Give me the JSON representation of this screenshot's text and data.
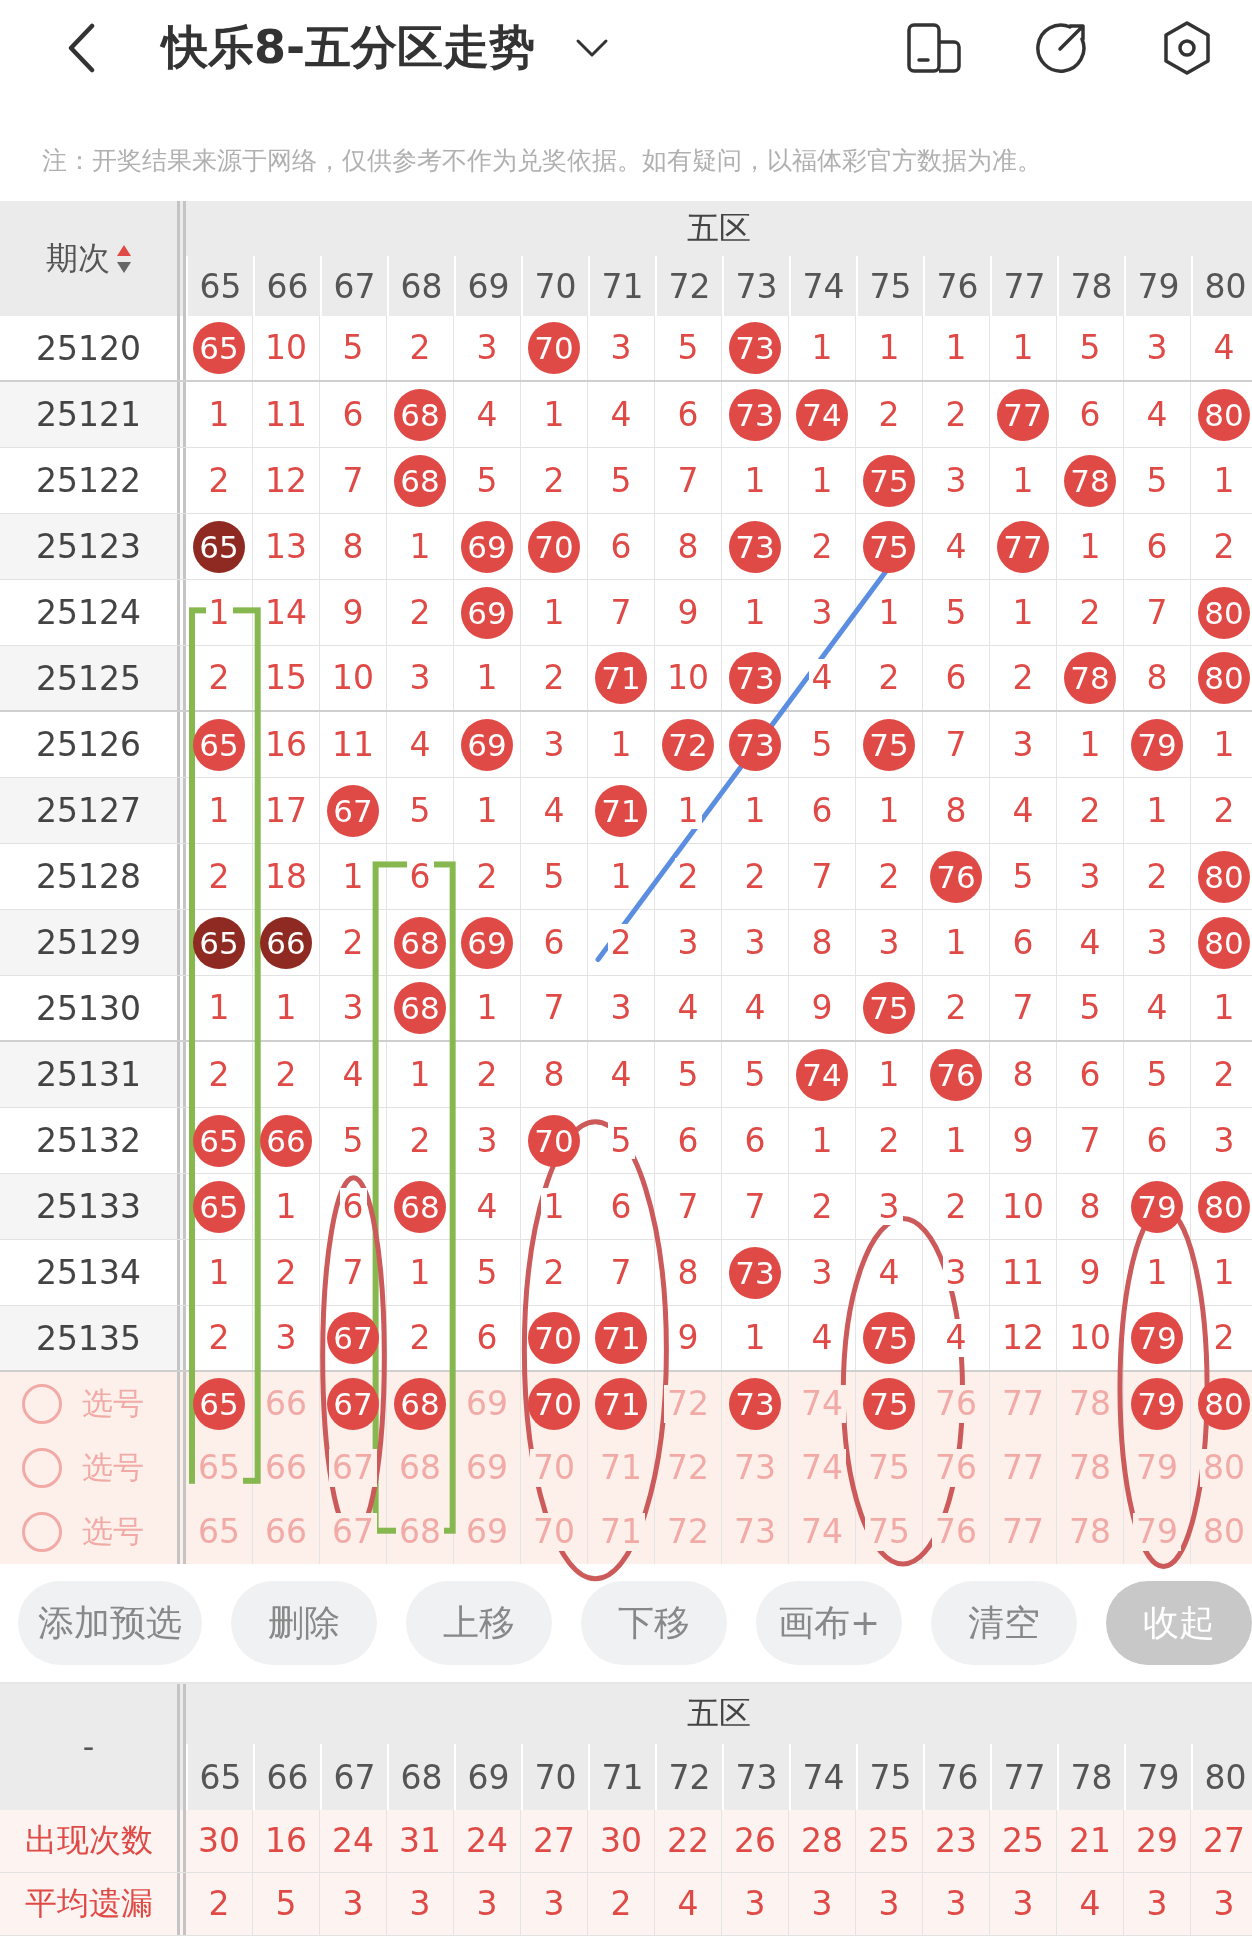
{
  "header": {
    "title": "快乐8-五分区走势"
  },
  "note": "注：开奖结果来源于网络，仅供参考不作为兑奖依据。如有疑问，以福体彩官方数据为准。",
  "trend_table": {
    "issue_heading": "期次",
    "group_heading": "五区",
    "columns": [
      "65",
      "66",
      "67",
      "68",
      "69",
      "70",
      "71",
      "72",
      "73",
      "74",
      "75",
      "76",
      "77",
      "78",
      "79",
      "80"
    ],
    "rows": [
      {
        "issue": "25120",
        "cells": [
          {
            "text": "65",
            "kind": "hit"
          },
          {
            "text": "10",
            "kind": "miss"
          },
          {
            "text": "5",
            "kind": "miss"
          },
          {
            "text": "2",
            "kind": "miss"
          },
          {
            "text": "3",
            "kind": "miss"
          },
          {
            "text": "70",
            "kind": "hit"
          },
          {
            "text": "3",
            "kind": "miss"
          },
          {
            "text": "5",
            "kind": "miss"
          },
          {
            "text": "73",
            "kind": "hit"
          },
          {
            "text": "1",
            "kind": "miss"
          },
          {
            "text": "1",
            "kind": "miss"
          },
          {
            "text": "1",
            "kind": "miss"
          },
          {
            "text": "1",
            "kind": "miss"
          },
          {
            "text": "5",
            "kind": "miss"
          },
          {
            "text": "3",
            "kind": "miss"
          },
          {
            "text": "4",
            "kind": "miss"
          }
        ]
      },
      {
        "issue": "25121",
        "cells": [
          {
            "text": "1",
            "kind": "miss"
          },
          {
            "text": "11",
            "kind": "miss"
          },
          {
            "text": "6",
            "kind": "miss"
          },
          {
            "text": "68",
            "kind": "hit"
          },
          {
            "text": "4",
            "kind": "miss"
          },
          {
            "text": "1",
            "kind": "miss"
          },
          {
            "text": "4",
            "kind": "miss"
          },
          {
            "text": "6",
            "kind": "miss"
          },
          {
            "text": "73",
            "kind": "hit"
          },
          {
            "text": "74",
            "kind": "hit"
          },
          {
            "text": "2",
            "kind": "miss"
          },
          {
            "text": "2",
            "kind": "miss"
          },
          {
            "text": "77",
            "kind": "hit"
          },
          {
            "text": "6",
            "kind": "miss"
          },
          {
            "text": "4",
            "kind": "miss"
          },
          {
            "text": "80",
            "kind": "hit"
          }
        ]
      },
      {
        "issue": "25122",
        "cells": [
          {
            "text": "2",
            "kind": "miss"
          },
          {
            "text": "12",
            "kind": "miss"
          },
          {
            "text": "7",
            "kind": "miss"
          },
          {
            "text": "68",
            "kind": "hit"
          },
          {
            "text": "5",
            "kind": "miss"
          },
          {
            "text": "2",
            "kind": "miss"
          },
          {
            "text": "5",
            "kind": "miss"
          },
          {
            "text": "7",
            "kind": "miss"
          },
          {
            "text": "1",
            "kind": "miss"
          },
          {
            "text": "1",
            "kind": "miss"
          },
          {
            "text": "75",
            "kind": "hit"
          },
          {
            "text": "3",
            "kind": "miss"
          },
          {
            "text": "1",
            "kind": "miss"
          },
          {
            "text": "78",
            "kind": "hit"
          },
          {
            "text": "5",
            "kind": "miss"
          },
          {
            "text": "1",
            "kind": "miss"
          }
        ]
      },
      {
        "issue": "25123",
        "cells": [
          {
            "text": "65",
            "kind": "repeat"
          },
          {
            "text": "13",
            "kind": "miss"
          },
          {
            "text": "8",
            "kind": "miss"
          },
          {
            "text": "1",
            "kind": "miss"
          },
          {
            "text": "69",
            "kind": "hit"
          },
          {
            "text": "70",
            "kind": "hit"
          },
          {
            "text": "6",
            "kind": "miss"
          },
          {
            "text": "8",
            "kind": "miss"
          },
          {
            "text": "73",
            "kind": "hit"
          },
          {
            "text": "2",
            "kind": "miss"
          },
          {
            "text": "75",
            "kind": "hit"
          },
          {
            "text": "4",
            "kind": "miss"
          },
          {
            "text": "77",
            "kind": "hit"
          },
          {
            "text": "1",
            "kind": "miss"
          },
          {
            "text": "6",
            "kind": "miss"
          },
          {
            "text": "2",
            "kind": "miss"
          }
        ]
      },
      {
        "issue": "25124",
        "cells": [
          {
            "text": "1",
            "kind": "miss"
          },
          {
            "text": "14",
            "kind": "miss"
          },
          {
            "text": "9",
            "kind": "miss"
          },
          {
            "text": "2",
            "kind": "miss"
          },
          {
            "text": "69",
            "kind": "hit"
          },
          {
            "text": "1",
            "kind": "miss"
          },
          {
            "text": "7",
            "kind": "miss"
          },
          {
            "text": "9",
            "kind": "miss"
          },
          {
            "text": "1",
            "kind": "miss"
          },
          {
            "text": "3",
            "kind": "miss"
          },
          {
            "text": "1",
            "kind": "miss"
          },
          {
            "text": "5",
            "kind": "miss"
          },
          {
            "text": "1",
            "kind": "miss"
          },
          {
            "text": "2",
            "kind": "miss"
          },
          {
            "text": "7",
            "kind": "miss"
          },
          {
            "text": "80",
            "kind": "hit"
          }
        ]
      },
      {
        "issue": "25125",
        "cells": [
          {
            "text": "2",
            "kind": "miss"
          },
          {
            "text": "15",
            "kind": "miss"
          },
          {
            "text": "10",
            "kind": "miss"
          },
          {
            "text": "3",
            "kind": "miss"
          },
          {
            "text": "1",
            "kind": "miss"
          },
          {
            "text": "2",
            "kind": "miss"
          },
          {
            "text": "71",
            "kind": "hit"
          },
          {
            "text": "10",
            "kind": "miss"
          },
          {
            "text": "73",
            "kind": "hit"
          },
          {
            "text": "4",
            "kind": "miss"
          },
          {
            "text": "2",
            "kind": "miss"
          },
          {
            "text": "6",
            "kind": "miss"
          },
          {
            "text": "2",
            "kind": "miss"
          },
          {
            "text": "78",
            "kind": "hit"
          },
          {
            "text": "8",
            "kind": "miss"
          },
          {
            "text": "80",
            "kind": "hit"
          }
        ]
      },
      {
        "issue": "25126",
        "cells": [
          {
            "text": "65",
            "kind": "hit"
          },
          {
            "text": "16",
            "kind": "miss"
          },
          {
            "text": "11",
            "kind": "miss"
          },
          {
            "text": "4",
            "kind": "miss"
          },
          {
            "text": "69",
            "kind": "hit"
          },
          {
            "text": "3",
            "kind": "miss"
          },
          {
            "text": "1",
            "kind": "miss"
          },
          {
            "text": "72",
            "kind": "hit"
          },
          {
            "text": "73",
            "kind": "hit"
          },
          {
            "text": "5",
            "kind": "miss"
          },
          {
            "text": "75",
            "kind": "hit"
          },
          {
            "text": "7",
            "kind": "miss"
          },
          {
            "text": "3",
            "kind": "miss"
          },
          {
            "text": "1",
            "kind": "miss"
          },
          {
            "text": "79",
            "kind": "hit"
          },
          {
            "text": "1",
            "kind": "miss"
          }
        ]
      },
      {
        "issue": "25127",
        "cells": [
          {
            "text": "1",
            "kind": "miss"
          },
          {
            "text": "17",
            "kind": "miss"
          },
          {
            "text": "67",
            "kind": "hit"
          },
          {
            "text": "5",
            "kind": "miss"
          },
          {
            "text": "1",
            "kind": "miss"
          },
          {
            "text": "4",
            "kind": "miss"
          },
          {
            "text": "71",
            "kind": "hit"
          },
          {
            "text": "1",
            "kind": "miss"
          },
          {
            "text": "1",
            "kind": "miss"
          },
          {
            "text": "6",
            "kind": "miss"
          },
          {
            "text": "1",
            "kind": "miss"
          },
          {
            "text": "8",
            "kind": "miss"
          },
          {
            "text": "4",
            "kind": "miss"
          },
          {
            "text": "2",
            "kind": "miss"
          },
          {
            "text": "1",
            "kind": "miss"
          },
          {
            "text": "2",
            "kind": "miss"
          }
        ]
      },
      {
        "issue": "25128",
        "cells": [
          {
            "text": "2",
            "kind": "miss"
          },
          {
            "text": "18",
            "kind": "miss"
          },
          {
            "text": "1",
            "kind": "miss"
          },
          {
            "text": "6",
            "kind": "miss"
          },
          {
            "text": "2",
            "kind": "miss"
          },
          {
            "text": "5",
            "kind": "miss"
          },
          {
            "text": "1",
            "kind": "miss"
          },
          {
            "text": "2",
            "kind": "miss"
          },
          {
            "text": "2",
            "kind": "miss"
          },
          {
            "text": "7",
            "kind": "miss"
          },
          {
            "text": "2",
            "kind": "miss"
          },
          {
            "text": "76",
            "kind": "hit"
          },
          {
            "text": "5",
            "kind": "miss"
          },
          {
            "text": "3",
            "kind": "miss"
          },
          {
            "text": "2",
            "kind": "miss"
          },
          {
            "text": "80",
            "kind": "hit"
          }
        ]
      },
      {
        "issue": "25129",
        "cells": [
          {
            "text": "65",
            "kind": "repeat"
          },
          {
            "text": "66",
            "kind": "repeat"
          },
          {
            "text": "2",
            "kind": "miss"
          },
          {
            "text": "68",
            "kind": "hit"
          },
          {
            "text": "69",
            "kind": "hit"
          },
          {
            "text": "6",
            "kind": "miss"
          },
          {
            "text": "2",
            "kind": "miss"
          },
          {
            "text": "3",
            "kind": "miss"
          },
          {
            "text": "3",
            "kind": "miss"
          },
          {
            "text": "8",
            "kind": "miss"
          },
          {
            "text": "3",
            "kind": "miss"
          },
          {
            "text": "1",
            "kind": "miss"
          },
          {
            "text": "6",
            "kind": "miss"
          },
          {
            "text": "4",
            "kind": "miss"
          },
          {
            "text": "3",
            "kind": "miss"
          },
          {
            "text": "80",
            "kind": "hit"
          }
        ]
      },
      {
        "issue": "25130",
        "cells": [
          {
            "text": "1",
            "kind": "miss"
          },
          {
            "text": "1",
            "kind": "miss"
          },
          {
            "text": "3",
            "kind": "miss"
          },
          {
            "text": "68",
            "kind": "hit"
          },
          {
            "text": "1",
            "kind": "miss"
          },
          {
            "text": "7",
            "kind": "miss"
          },
          {
            "text": "3",
            "kind": "miss"
          },
          {
            "text": "4",
            "kind": "miss"
          },
          {
            "text": "4",
            "kind": "miss"
          },
          {
            "text": "9",
            "kind": "miss"
          },
          {
            "text": "75",
            "kind": "hit"
          },
          {
            "text": "2",
            "kind": "miss"
          },
          {
            "text": "7",
            "kind": "miss"
          },
          {
            "text": "5",
            "kind": "miss"
          },
          {
            "text": "4",
            "kind": "miss"
          },
          {
            "text": "1",
            "kind": "miss"
          }
        ]
      },
      {
        "issue": "25131",
        "cells": [
          {
            "text": "2",
            "kind": "miss"
          },
          {
            "text": "2",
            "kind": "miss"
          },
          {
            "text": "4",
            "kind": "miss"
          },
          {
            "text": "1",
            "kind": "miss"
          },
          {
            "text": "2",
            "kind": "miss"
          },
          {
            "text": "8",
            "kind": "miss"
          },
          {
            "text": "4",
            "kind": "miss"
          },
          {
            "text": "5",
            "kind": "miss"
          },
          {
            "text": "5",
            "kind": "miss"
          },
          {
            "text": "74",
            "kind": "hit"
          },
          {
            "text": "1",
            "kind": "miss"
          },
          {
            "text": "76",
            "kind": "hit"
          },
          {
            "text": "8",
            "kind": "miss"
          },
          {
            "text": "6",
            "kind": "miss"
          },
          {
            "text": "5",
            "kind": "miss"
          },
          {
            "text": "2",
            "kind": "miss"
          }
        ]
      },
      {
        "issue": "25132",
        "cells": [
          {
            "text": "65",
            "kind": "hit"
          },
          {
            "text": "66",
            "kind": "hit"
          },
          {
            "text": "5",
            "kind": "miss"
          },
          {
            "text": "2",
            "kind": "miss"
          },
          {
            "text": "3",
            "kind": "miss"
          },
          {
            "text": "70",
            "kind": "hit"
          },
          {
            "text": "5",
            "kind": "miss"
          },
          {
            "text": "6",
            "kind": "miss"
          },
          {
            "text": "6",
            "kind": "miss"
          },
          {
            "text": "1",
            "kind": "miss"
          },
          {
            "text": "2",
            "kind": "miss"
          },
          {
            "text": "1",
            "kind": "miss"
          },
          {
            "text": "9",
            "kind": "miss"
          },
          {
            "text": "7",
            "kind": "miss"
          },
          {
            "text": "6",
            "kind": "miss"
          },
          {
            "text": "3",
            "kind": "miss"
          }
        ]
      },
      {
        "issue": "25133",
        "cells": [
          {
            "text": "65",
            "kind": "hit"
          },
          {
            "text": "1",
            "kind": "miss"
          },
          {
            "text": "6",
            "kind": "miss"
          },
          {
            "text": "68",
            "kind": "hit"
          },
          {
            "text": "4",
            "kind": "miss"
          },
          {
            "text": "1",
            "kind": "miss"
          },
          {
            "text": "6",
            "kind": "miss"
          },
          {
            "text": "7",
            "kind": "miss"
          },
          {
            "text": "7",
            "kind": "miss"
          },
          {
            "text": "2",
            "kind": "miss"
          },
          {
            "text": "3",
            "kind": "miss"
          },
          {
            "text": "2",
            "kind": "miss"
          },
          {
            "text": "10",
            "kind": "miss"
          },
          {
            "text": "8",
            "kind": "miss"
          },
          {
            "text": "79",
            "kind": "hit"
          },
          {
            "text": "80",
            "kind": "hit"
          }
        ]
      },
      {
        "issue": "25134",
        "cells": [
          {
            "text": "1",
            "kind": "miss"
          },
          {
            "text": "2",
            "kind": "miss"
          },
          {
            "text": "7",
            "kind": "miss"
          },
          {
            "text": "1",
            "kind": "miss"
          },
          {
            "text": "5",
            "kind": "miss"
          },
          {
            "text": "2",
            "kind": "miss"
          },
          {
            "text": "7",
            "kind": "miss"
          },
          {
            "text": "8",
            "kind": "miss"
          },
          {
            "text": "73",
            "kind": "hit"
          },
          {
            "text": "3",
            "kind": "miss"
          },
          {
            "text": "4",
            "kind": "miss"
          },
          {
            "text": "3",
            "kind": "miss"
          },
          {
            "text": "11",
            "kind": "miss"
          },
          {
            "text": "9",
            "kind": "miss"
          },
          {
            "text": "1",
            "kind": "miss"
          },
          {
            "text": "1",
            "kind": "miss"
          }
        ]
      },
      {
        "issue": "25135",
        "cells": [
          {
            "text": "2",
            "kind": "miss"
          },
          {
            "text": "3",
            "kind": "miss"
          },
          {
            "text": "67",
            "kind": "hit"
          },
          {
            "text": "2",
            "kind": "miss"
          },
          {
            "text": "6",
            "kind": "miss"
          },
          {
            "text": "70",
            "kind": "hit"
          },
          {
            "text": "71",
            "kind": "hit"
          },
          {
            "text": "9",
            "kind": "miss"
          },
          {
            "text": "1",
            "kind": "miss"
          },
          {
            "text": "4",
            "kind": "miss"
          },
          {
            "text": "75",
            "kind": "hit"
          },
          {
            "text": "4",
            "kind": "miss"
          },
          {
            "text": "12",
            "kind": "miss"
          },
          {
            "text": "10",
            "kind": "miss"
          },
          {
            "text": "79",
            "kind": "hit"
          },
          {
            "text": "2",
            "kind": "miss"
          }
        ]
      }
    ],
    "pick_rows": [
      {
        "label": "选号",
        "selected": false,
        "cells": [
          {
            "text": "65",
            "kind": "hit"
          },
          {
            "text": "66",
            "kind": "faint"
          },
          {
            "text": "67",
            "kind": "hit"
          },
          {
            "text": "68",
            "kind": "hit"
          },
          {
            "text": "69",
            "kind": "faint"
          },
          {
            "text": "70",
            "kind": "hit"
          },
          {
            "text": "71",
            "kind": "hit"
          },
          {
            "text": "72",
            "kind": "faint"
          },
          {
            "text": "73",
            "kind": "hit"
          },
          {
            "text": "74",
            "kind": "faint"
          },
          {
            "text": "75",
            "kind": "hit"
          },
          {
            "text": "76",
            "kind": "faint"
          },
          {
            "text": "77",
            "kind": "faint"
          },
          {
            "text": "78",
            "kind": "faint"
          },
          {
            "text": "79",
            "kind": "hit"
          },
          {
            "text": "80",
            "kind": "hit"
          }
        ]
      },
      {
        "label": "选号",
        "selected": false,
        "cells": [
          {
            "text": "65",
            "kind": "faint"
          },
          {
            "text": "66",
            "kind": "faint"
          },
          {
            "text": "67",
            "kind": "faint"
          },
          {
            "text": "68",
            "kind": "faint"
          },
          {
            "text": "69",
            "kind": "faint"
          },
          {
            "text": "70",
            "kind": "faint"
          },
          {
            "text": "71",
            "kind": "faint"
          },
          {
            "text": "72",
            "kind": "faint"
          },
          {
            "text": "73",
            "kind": "faint"
          },
          {
            "text": "74",
            "kind": "faint"
          },
          {
            "text": "75",
            "kind": "faint"
          },
          {
            "text": "76",
            "kind": "faint"
          },
          {
            "text": "77",
            "kind": "faint"
          },
          {
            "text": "78",
            "kind": "faint"
          },
          {
            "text": "79",
            "kind": "faint"
          },
          {
            "text": "80",
            "kind": "faint"
          }
        ]
      },
      {
        "label": "选号",
        "selected": false,
        "cells": [
          {
            "text": "65",
            "kind": "faint"
          },
          {
            "text": "66",
            "kind": "faint"
          },
          {
            "text": "67",
            "kind": "faint"
          },
          {
            "text": "68",
            "kind": "faint"
          },
          {
            "text": "69",
            "kind": "faint"
          },
          {
            "text": "70",
            "kind": "faint"
          },
          {
            "text": "71",
            "kind": "faint"
          },
          {
            "text": "72",
            "kind": "faint"
          },
          {
            "text": "73",
            "kind": "faint"
          },
          {
            "text": "74",
            "kind": "faint"
          },
          {
            "text": "75",
            "kind": "faint"
          },
          {
            "text": "76",
            "kind": "faint"
          },
          {
            "text": "77",
            "kind": "faint"
          },
          {
            "text": "78",
            "kind": "faint"
          },
          {
            "text": "79",
            "kind": "faint"
          },
          {
            "text": "80",
            "kind": "faint"
          }
        ]
      }
    ]
  },
  "buttons": [
    {
      "label": "添加预选",
      "kind": "pill"
    },
    {
      "label": "删除",
      "kind": "pill"
    },
    {
      "label": "上移",
      "kind": "pill"
    },
    {
      "label": "下移",
      "kind": "pill"
    },
    {
      "label": "画布+",
      "kind": "pill"
    },
    {
      "label": "清空",
      "kind": "pill"
    },
    {
      "label": "收起",
      "kind": "collapse"
    }
  ],
  "stats_table": {
    "corner": "-",
    "group_heading": "五区",
    "columns": [
      "65",
      "66",
      "67",
      "68",
      "69",
      "70",
      "71",
      "72",
      "73",
      "74",
      "75",
      "76",
      "77",
      "78",
      "79",
      "80"
    ],
    "rows": [
      {
        "label": "出现次数",
        "values": [
          "30",
          "16",
          "24",
          "31",
          "24",
          "27",
          "30",
          "22",
          "26",
          "28",
          "25",
          "23",
          "25",
          "21",
          "29",
          "27"
        ]
      },
      {
        "label": "平均遗漏",
        "values": [
          "2",
          "5",
          "3",
          "3",
          "3",
          "3",
          "2",
          "4",
          "3",
          "3",
          "3",
          "3",
          "3",
          "4",
          "3",
          "3"
        ]
      }
    ]
  }
}
